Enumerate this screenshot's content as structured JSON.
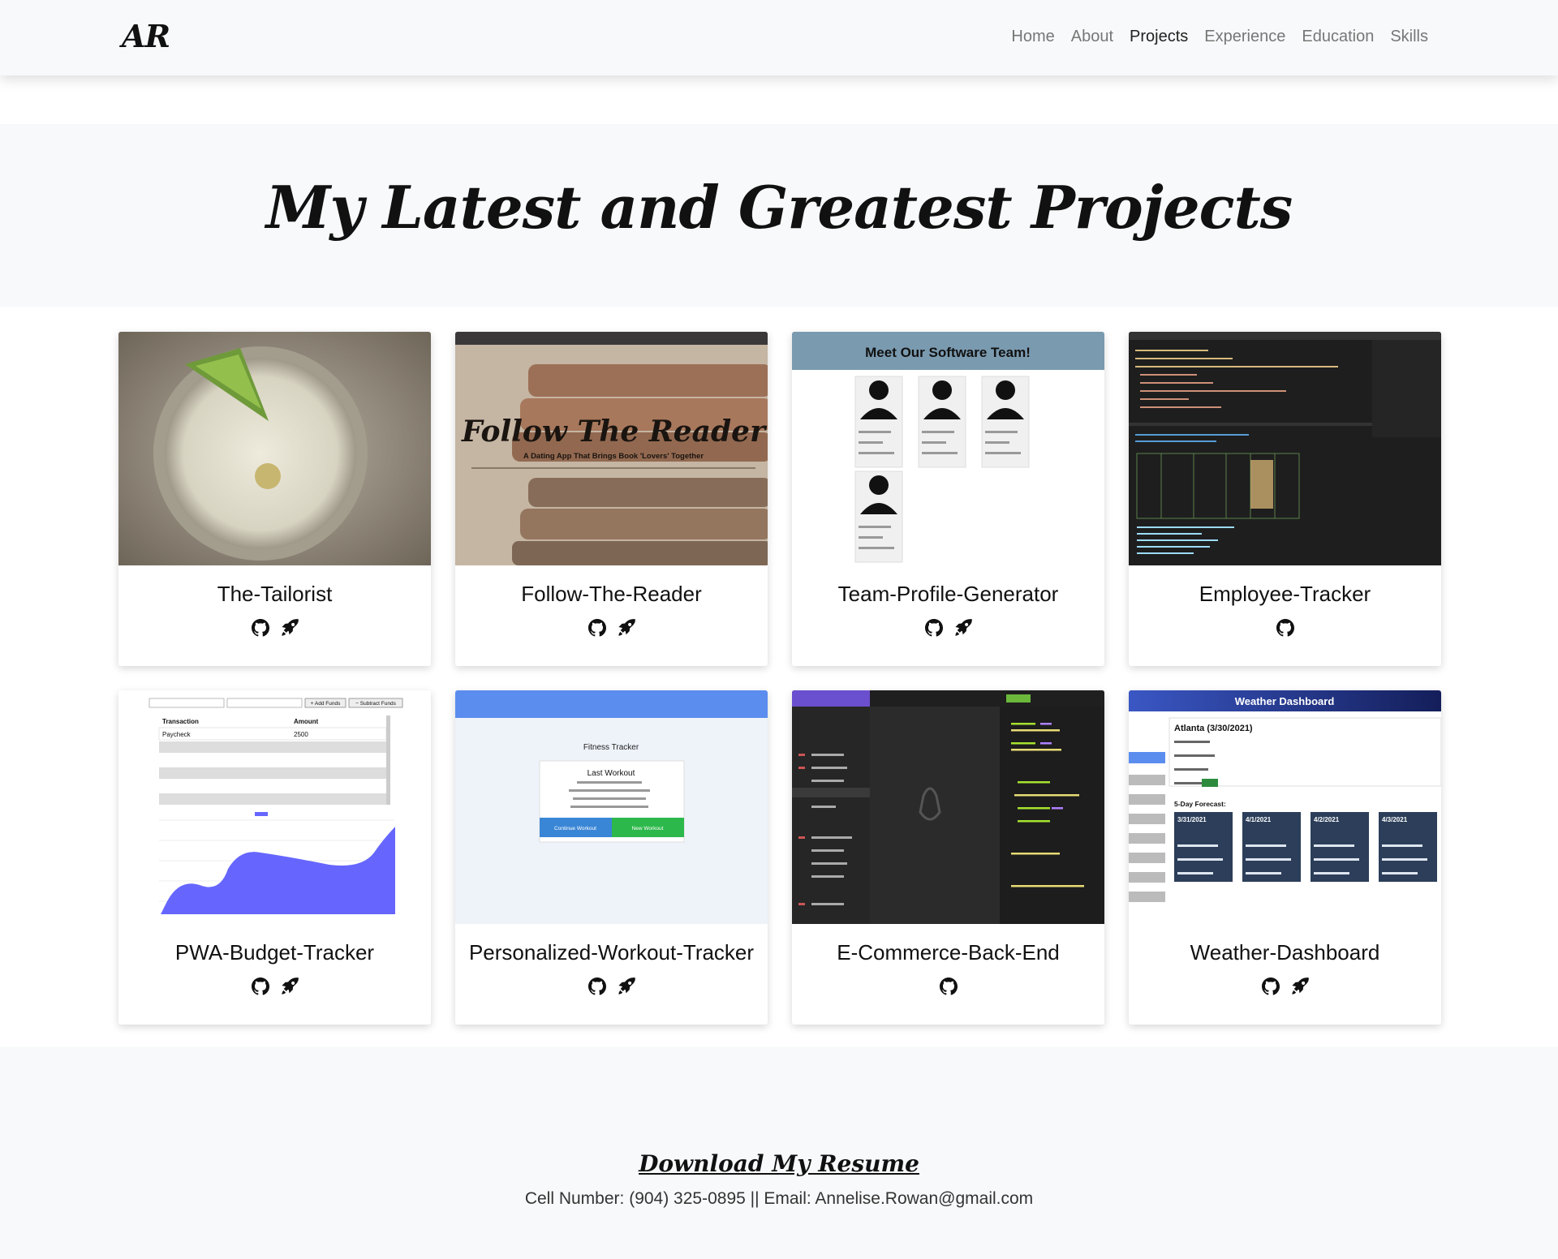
{
  "brand": "AR",
  "nav": [
    {
      "label": "Home",
      "active": false
    },
    {
      "label": "About",
      "active": false
    },
    {
      "label": "Projects",
      "active": true
    },
    {
      "label": "Experience",
      "active": false
    },
    {
      "label": "Education",
      "active": false
    },
    {
      "label": "Skills",
      "active": false
    }
  ],
  "hero": {
    "title": "My Latest and Greatest Projects"
  },
  "projects": [
    {
      "title": "The-Tailorist",
      "links": [
        "github-icon",
        "rocket-icon"
      ]
    },
    {
      "title": "Follow-The-Reader",
      "links": [
        "github-icon",
        "rocket-icon"
      ],
      "thumb_text": {
        "heading": "Follow The Reader",
        "sub": "A Dating App That Brings Book 'Lovers' Together"
      }
    },
    {
      "title": "Team-Profile-Generator",
      "links": [
        "github-icon",
        "rocket-icon"
      ],
      "thumb_text": {
        "heading": "Meet Our Software Team!"
      }
    },
    {
      "title": "Employee-Tracker",
      "links": [
        "github-icon"
      ]
    },
    {
      "title": "PWA-Budget-Tracker",
      "links": [
        "github-icon",
        "rocket-icon"
      ],
      "thumb_text": {
        "col1": "Transaction",
        "col2": "Amount",
        "row1": "Paycheck",
        "val1": "2500",
        "add": "+ Add Funds",
        "sub": "− Subtract Funds"
      }
    },
    {
      "title": "Personalized-Workout-Tracker",
      "links": [
        "github-icon",
        "rocket-icon"
      ],
      "thumb_text": {
        "heading": "Fitness Tracker",
        "card": "Last Workout",
        "btn1": "Continue Workout",
        "btn2": "New Workout"
      }
    },
    {
      "title": "E-Commerce-Back-End",
      "links": [
        "github-icon"
      ]
    },
    {
      "title": "Weather-Dashboard",
      "links": [
        "github-icon",
        "rocket-icon"
      ],
      "thumb_text": {
        "heading": "Weather Dashboard",
        "city": "Atlanta (3/30/2021)",
        "forecast": "5-Day Forecast:",
        "days": [
          "3/31/2021",
          "4/1/2021",
          "4/2/2021",
          "4/3/2021"
        ]
      }
    }
  ],
  "footer": {
    "resume": "Download My Resume",
    "contact": "Cell Number: (904) 325-0895 || Email: Annelise.Rowan@gmail.com"
  },
  "colors": {
    "navbar_bg": "#f8f9fa",
    "section_bg": "#f8f9fa",
    "text": "#111111",
    "nav_muted": "#777777"
  }
}
